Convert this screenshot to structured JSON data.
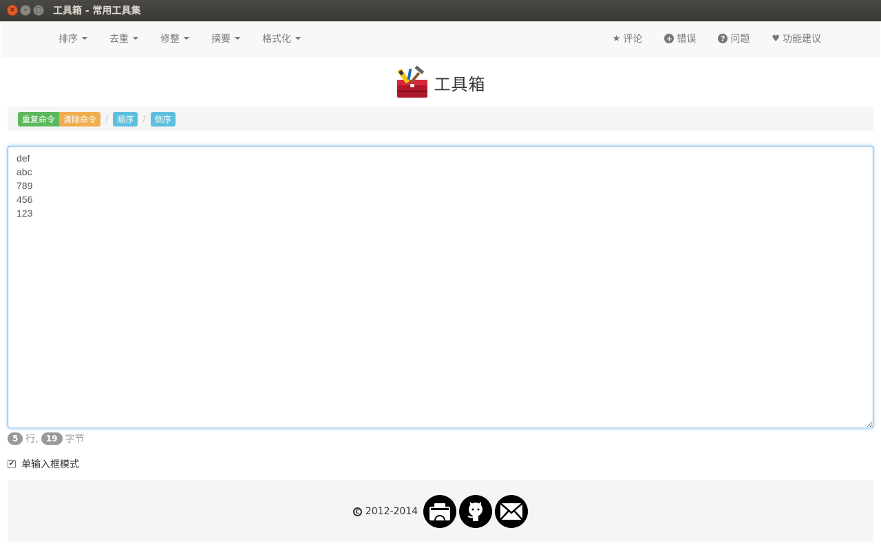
{
  "window": {
    "title": "工具箱 - 常用工具集"
  },
  "navbar": {
    "left_menus": [
      {
        "label": "排序"
      },
      {
        "label": "去重"
      },
      {
        "label": "修整"
      },
      {
        "label": "摘要"
      },
      {
        "label": "格式化"
      }
    ],
    "right_links": [
      {
        "icon": "star-icon",
        "label": "评论"
      },
      {
        "icon": "plus-circle-icon",
        "label": "错误"
      },
      {
        "icon": "question-circle-icon",
        "label": "问题"
      },
      {
        "icon": "heart-icon",
        "label": "功能建议"
      }
    ]
  },
  "header": {
    "title": "工具箱"
  },
  "toolbar": {
    "repeat_label": "重复命令",
    "clear_label": "清除命令",
    "order_label": "顺序",
    "reverse_label": "倒序"
  },
  "editor": {
    "content": "def\nabc\n789\n456\n123"
  },
  "stats": {
    "lines": "5",
    "lines_unit": "行,",
    "bytes": "19",
    "bytes_unit": "字节"
  },
  "mode": {
    "label": "单输入框模式",
    "checked": true
  },
  "footer": {
    "copyright": "2012-2014"
  },
  "colors": {
    "green": "#5cb85c",
    "orange": "#f0ad4e",
    "blue": "#5bc0de",
    "focus": "#66afe9"
  }
}
